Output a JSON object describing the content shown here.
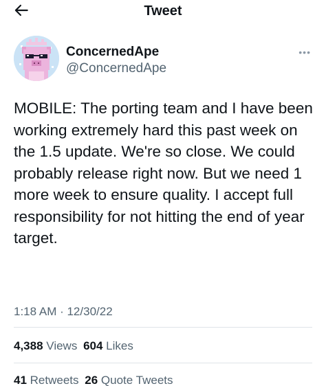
{
  "header": {
    "title": "Tweet",
    "back_icon": "arrow-left-icon"
  },
  "author": {
    "display_name": "ConcernedApe",
    "handle": "@ConcernedApe",
    "avatar_icon": "pixel-pig-avatar",
    "more_icon": "ellipsis-icon"
  },
  "tweet": {
    "text": "MOBILE: The porting team and I have been working extremely hard this past week on the 1.5 update. We're so close. We could probably release right now. But we need 1 more week to ensure quality. I accept full responsibility for not hitting the end of year target.",
    "timestamp": "1:18 AM · 12/30/22"
  },
  "stats": {
    "views_count": "4,388",
    "views_label": "Views",
    "likes_count": "604",
    "likes_label": "Likes",
    "retweets_count": "41",
    "retweets_label": "Retweets",
    "quotes_count": "26",
    "quotes_label": "Quote Tweets"
  },
  "colors": {
    "text_primary": "#0f1419",
    "text_secondary": "#536471",
    "divider": "#dfe4e8",
    "avatar_bg": "#cbe3f6"
  }
}
